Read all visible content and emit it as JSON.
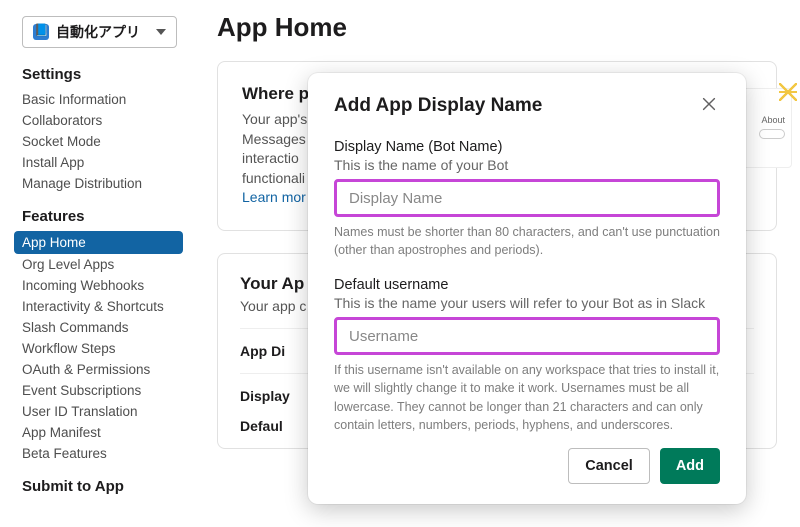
{
  "workspace": {
    "name": "自動化アプリ"
  },
  "sidebar": {
    "settings_head": "Settings",
    "settings": [
      {
        "label": "Basic Information"
      },
      {
        "label": "Collaborators"
      },
      {
        "label": "Socket Mode"
      },
      {
        "label": "Install App"
      },
      {
        "label": "Manage Distribution"
      }
    ],
    "features_head": "Features",
    "features": [
      {
        "label": "App Home"
      },
      {
        "label": "Org Level Apps"
      },
      {
        "label": "Incoming Webhooks"
      },
      {
        "label": "Interactivity & Shortcuts"
      },
      {
        "label": "Slash Commands"
      },
      {
        "label": "Workflow Steps"
      },
      {
        "label": "OAuth & Permissions"
      },
      {
        "label": "Event Subscriptions"
      },
      {
        "label": "User ID Translation"
      },
      {
        "label": "App Manifest"
      },
      {
        "label": "Beta Features"
      }
    ],
    "submit_head": "Submit to App"
  },
  "main": {
    "title": "App Home",
    "card1": {
      "head": "Where p",
      "desc_lines": [
        "Your app's",
        "Messages",
        "interactio",
        "functionali"
      ],
      "learn_more": "Learn mor"
    },
    "card2": {
      "head": "Your Ap",
      "sub": "Your app c",
      "rows": [
        "App Di",
        "Display",
        "Defaul"
      ]
    },
    "preview": {
      "about": "About"
    }
  },
  "modal": {
    "title": "Add App Display Name",
    "display_name": {
      "label": "Display Name (Bot Name)",
      "sub": "This is the name of your Bot",
      "placeholder": "Display Name",
      "help": "Names must be shorter than 80 characters, and can't use punctuation (other than apostrophes and periods)."
    },
    "username": {
      "label": "Default username",
      "sub": "This is the name your users will refer to your Bot as in Slack",
      "placeholder": "Username",
      "help": "If this username isn't available on any workspace that tries to install it, we will slightly change it to make it work. Usernames must be all lowercase. They cannot be longer than 21 characters and can only contain letters, numbers, periods, hyphens, and underscores."
    },
    "actions": {
      "cancel": "Cancel",
      "add": "Add"
    }
  }
}
